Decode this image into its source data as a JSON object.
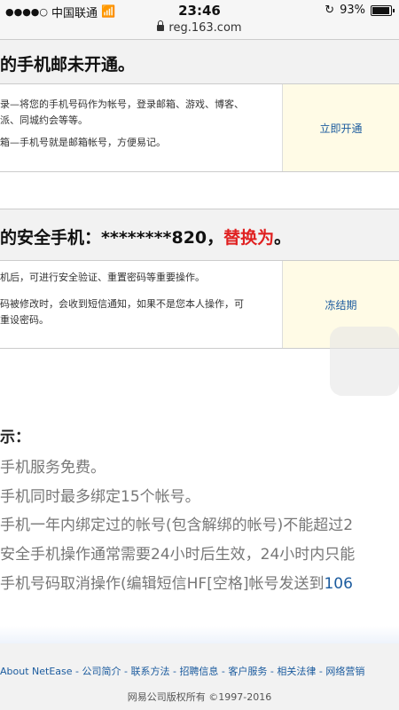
{
  "status": {
    "carrier": "中国联通",
    "time": "23:46",
    "battery": "93%",
    "battery_level": 0.93,
    "url": "reg.163.com"
  },
  "section1": {
    "header": "的手机邮未开通。",
    "line1": "录—将您的手机号码作为帐号，登录邮箱、游戏、博客、",
    "line2": "派、同城约会等等。",
    "line3": "箱—手机号就是邮箱帐号，方便易记。",
    "action": "立即开通"
  },
  "section2": {
    "header_prefix": "的安全手机：********820，",
    "header_action": "替换为",
    "header_suffix": "。",
    "line1": "机后，可进行安全验证、重置密码等重要操作。",
    "line2": "码被修改时，会收到短信通知，如果不是您本人操作，可",
    "line3": "重设密码。",
    "action": "冻结期"
  },
  "notes": {
    "title": "示：",
    "items": [
      "手机服务免费。",
      "手机同时最多绑定15个帐号。",
      "手机一年内绑定过的帐号(包含解绑的帐号)不能超过2",
      "安全手机操作通常需要24小时后生效，24小时内只能"
    ],
    "last_prefix": "手机号码取消操作(编辑短信HF[空格]帐号发送到",
    "last_link": "106"
  },
  "footer": {
    "links": [
      "About NetEase",
      "公司简介",
      "联系方法",
      "招聘信息",
      "客户服务",
      "相关法律",
      "网络营销"
    ],
    "separator": " - ",
    "copyright": "网易公司版权所有 ©1997-2016"
  },
  "colors": {
    "link": "#1b5b9e",
    "highlight_red": "#e02020",
    "action_bg": "#fffbe6"
  }
}
